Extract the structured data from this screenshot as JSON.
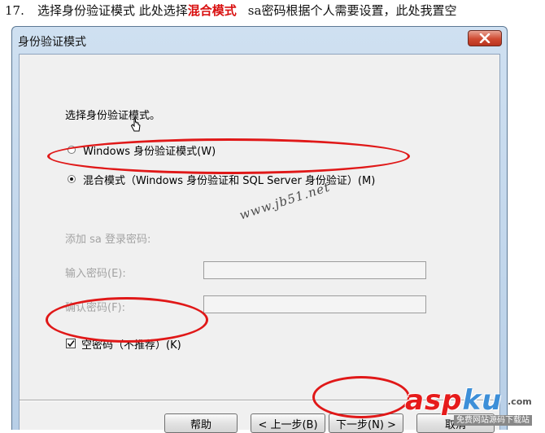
{
  "caption": {
    "number": "17.",
    "text_before": "选择身份验证模式 此处选择",
    "highlight": "混合模式",
    "text_after": "sa密码根据个人需要设置，此处我置空",
    "highlight_color": "#d91010"
  },
  "dialog": {
    "title": "身份验证模式",
    "heading": "选择身份验证模式。",
    "options": [
      {
        "label": "Windows 身份验证模式(W)",
        "selected": false
      },
      {
        "label": "混合模式（Windows 身份验证和 SQL Server 身份验证）(M)",
        "selected": true
      }
    ],
    "sa_section_label": "添加 sa 登录密码:",
    "password_label": "输入密码(E):",
    "password_value": "",
    "confirm_label": "确认密码(F):",
    "confirm_value": "",
    "blank_password": {
      "label": "空密码（不推荐）(K)",
      "checked": true
    },
    "buttons": {
      "help": "帮助",
      "back": "< 上一步(B)",
      "next": "下一步(N) >",
      "cancel": "取消"
    }
  },
  "overlay": {
    "watermark": "www.jb51.net",
    "logo_main": "asp",
    "logo_ku": "ku",
    "logo_com": ".com",
    "logo_sub": "免费网站源码下载站",
    "annotation_color": "#e01818"
  }
}
